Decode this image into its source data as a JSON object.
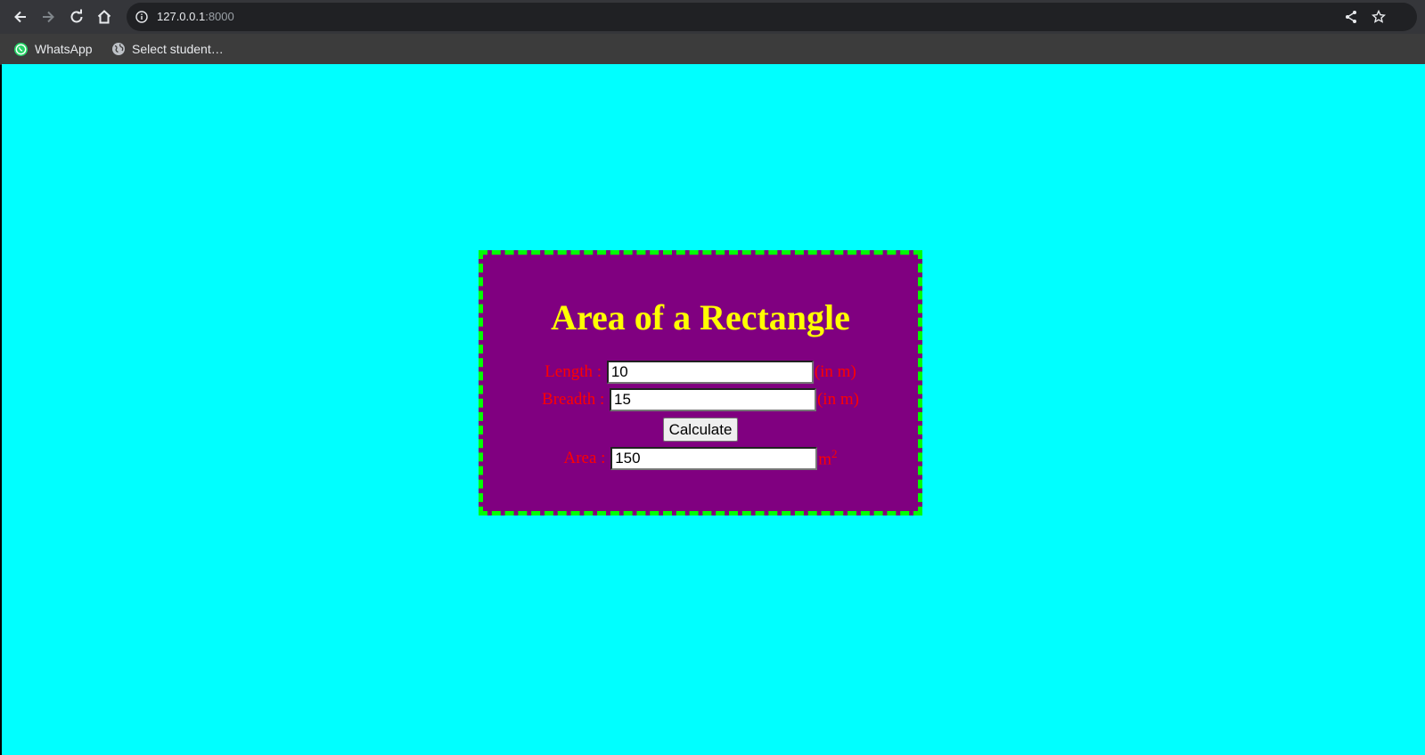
{
  "browser": {
    "url_host": "127.0.0.1",
    "url_port": ":8000",
    "bookmarks": [
      {
        "label": "WhatsApp",
        "icon": "whatsapp-icon"
      },
      {
        "label": "Select student…",
        "icon": "globe-icon"
      }
    ]
  },
  "page": {
    "background_color": "#00ffff",
    "box_color": "#800080",
    "border_color": "#00ff00",
    "title_color": "#ffff00",
    "label_color": "#ff0000",
    "title": "Area of a Rectangle",
    "length": {
      "label": "Length :",
      "value": "10",
      "unit": "(in m)"
    },
    "breadth": {
      "label": "Breadth :",
      "value": "15",
      "unit": "(in m)"
    },
    "calculate_label": "Calculate",
    "area": {
      "label": "Area :",
      "value": "150",
      "unit": "m",
      "unit_sup": "2"
    }
  }
}
